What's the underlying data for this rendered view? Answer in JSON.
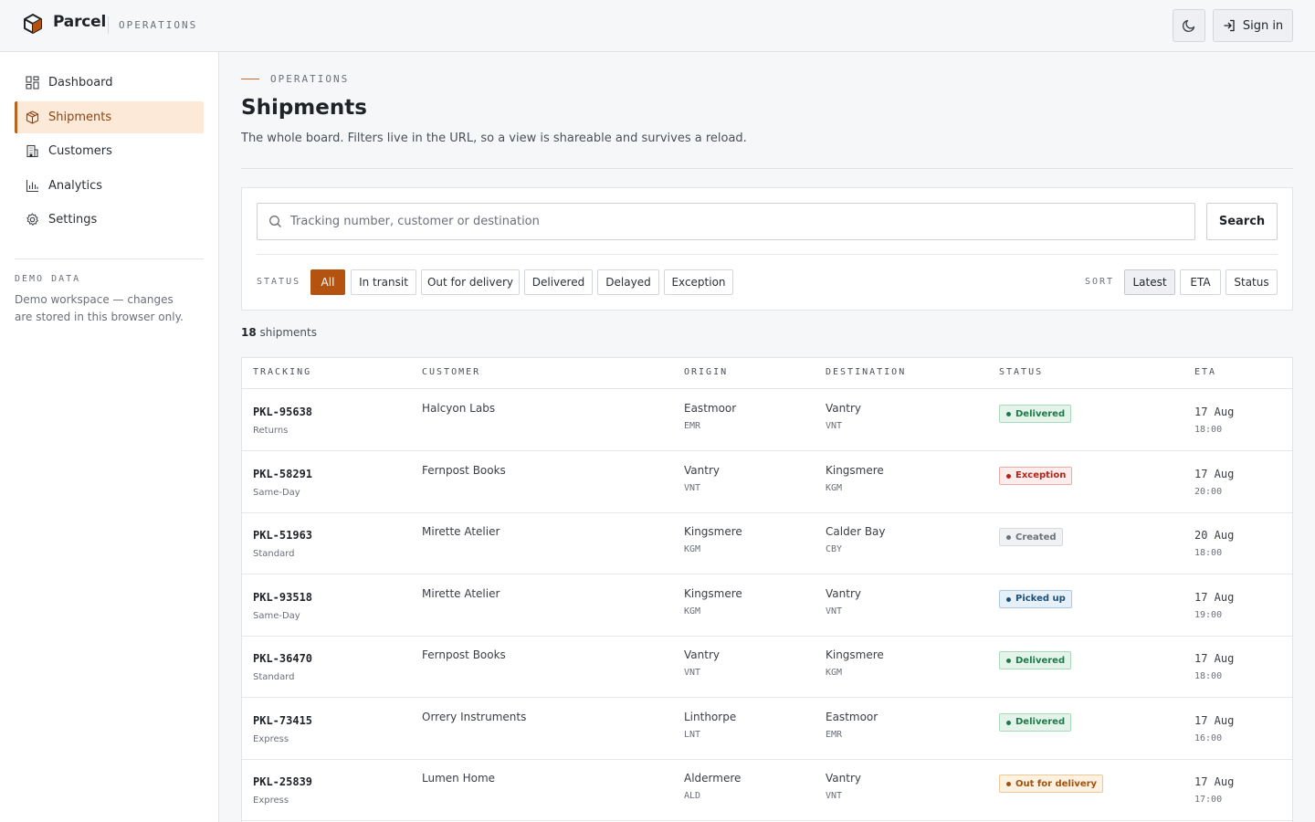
{
  "header": {
    "brand": "Parcel",
    "section": "OPERATIONS",
    "sign_in": "Sign in"
  },
  "sidebar": {
    "items": [
      {
        "label": "Dashboard",
        "icon": "dashboard-icon"
      },
      {
        "label": "Shipments",
        "icon": "package-icon",
        "active": true
      },
      {
        "label": "Customers",
        "icon": "building-icon"
      },
      {
        "label": "Analytics",
        "icon": "bar-chart-icon"
      },
      {
        "label": "Settings",
        "icon": "gear-icon"
      }
    ],
    "demo_label": "DEMO DATA",
    "demo_text": "Demo workspace — changes are stored in this browser only."
  },
  "main": {
    "eyebrow": "OPERATIONS",
    "title": "Shipments",
    "description": "The whole board. Filters live in the URL, so a view is shareable and survives a reload."
  },
  "filters": {
    "search_placeholder": "Tracking number, customer or destination",
    "search_button": "Search",
    "status_label": "STATUS",
    "statuses": [
      "All",
      "In transit",
      "Out for delivery",
      "Delivered",
      "Delayed",
      "Exception"
    ],
    "active_status": "All",
    "sort_label": "SORT",
    "sorts": [
      "Latest",
      "ETA",
      "Status"
    ],
    "active_sort": "Latest"
  },
  "results": {
    "count": "18",
    "count_suffix": "shipments"
  },
  "table": {
    "columns": [
      "TRACKING",
      "CUSTOMER",
      "ORIGIN",
      "DESTINATION",
      "STATUS",
      "ETA"
    ],
    "rows": [
      {
        "tracking": "PKL-95638",
        "service": "Returns",
        "customer": "Halcyon Labs",
        "origin": "Eastmoor",
        "origin_code": "EMR",
        "destination": "Vantry",
        "destination_code": "VNT",
        "status": "Delivered",
        "eta_date": "17 Aug",
        "eta_time": "18:00"
      },
      {
        "tracking": "PKL-58291",
        "service": "Same-Day",
        "customer": "Fernpost Books",
        "origin": "Vantry",
        "origin_code": "VNT",
        "destination": "Kingsmere",
        "destination_code": "KGM",
        "status": "Exception",
        "eta_date": "17 Aug",
        "eta_time": "20:00"
      },
      {
        "tracking": "PKL-51963",
        "service": "Standard",
        "customer": "Mirette Atelier",
        "origin": "Kingsmere",
        "origin_code": "KGM",
        "destination": "Calder Bay",
        "destination_code": "CBY",
        "status": "Created",
        "eta_date": "20 Aug",
        "eta_time": "18:00"
      },
      {
        "tracking": "PKL-93518",
        "service": "Same-Day",
        "customer": "Mirette Atelier",
        "origin": "Kingsmere",
        "origin_code": "KGM",
        "destination": "Vantry",
        "destination_code": "VNT",
        "status": "Picked up",
        "eta_date": "17 Aug",
        "eta_time": "19:00"
      },
      {
        "tracking": "PKL-36470",
        "service": "Standard",
        "customer": "Fernpost Books",
        "origin": "Vantry",
        "origin_code": "VNT",
        "destination": "Kingsmere",
        "destination_code": "KGM",
        "status": "Delivered",
        "eta_date": "17 Aug",
        "eta_time": "18:00"
      },
      {
        "tracking": "PKL-73415",
        "service": "Express",
        "customer": "Orrery Instruments",
        "origin": "Linthorpe",
        "origin_code": "LNT",
        "destination": "Eastmoor",
        "destination_code": "EMR",
        "status": "Delivered",
        "eta_date": "17 Aug",
        "eta_time": "16:00"
      },
      {
        "tracking": "PKL-25839",
        "service": "Express",
        "customer": "Lumen Home",
        "origin": "Aldermere",
        "origin_code": "ALD",
        "destination": "Vantry",
        "destination_code": "VNT",
        "status": "Out for delivery",
        "eta_date": "17 Aug",
        "eta_time": "17:00"
      }
    ]
  },
  "colors": {
    "accent": "#b4520f",
    "active_nav_bg": "#fde9d8",
    "status": {
      "Delivered": {
        "fg": "#1f7a4a",
        "bg": "#e4f4ea",
        "border": "#a9d9bb"
      },
      "Exception": {
        "fg": "#b42318",
        "bg": "#fdecec",
        "border": "#f1a9a3"
      },
      "Created": {
        "fg": "#6b7079",
        "bg": "#f1f2f4",
        "border": "#d6d9de"
      },
      "Picked up": {
        "fg": "#1d4f7a",
        "bg": "#e6f0f8",
        "border": "#a9c6df"
      },
      "Out for delivery": {
        "fg": "#a3520c",
        "bg": "#fdf1e2",
        "border": "#f0c894"
      }
    }
  }
}
